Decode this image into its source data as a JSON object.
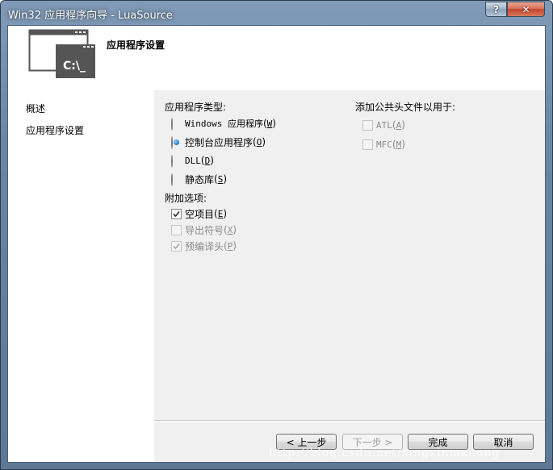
{
  "window": {
    "title": "Win32 应用程序向导 - LuaSource",
    "help_label": "?",
    "close_label": "✕"
  },
  "header": {
    "title": "应用程序设置",
    "logo_text": "C:\\_",
    "logo_icon": "console-window-icon"
  },
  "sidebar": {
    "items": [
      {
        "label": "概述"
      },
      {
        "label": "应用程序设置"
      }
    ]
  },
  "app_type": {
    "label": "应用程序类型:",
    "options": [
      {
        "text": "Windows 应用程序",
        "accel": "W",
        "selected": false
      },
      {
        "text": "控制台应用程序",
        "accel": "O",
        "selected": true
      },
      {
        "text": "DLL",
        "accel": "D",
        "selected": false
      },
      {
        "text": "静态库",
        "accel": "S",
        "selected": false
      }
    ]
  },
  "additional": {
    "label": "附加选项:",
    "options": [
      {
        "text": "空项目",
        "accel": "E",
        "checked": true,
        "enabled": true
      },
      {
        "text": "导出符号",
        "accel": "X",
        "checked": false,
        "enabled": false
      },
      {
        "text": "预编译头",
        "accel": "P",
        "checked": true,
        "enabled": false
      }
    ]
  },
  "common_headers": {
    "label": "添加公共头文件以用于:",
    "options": [
      {
        "text": "ATL",
        "accel": "A",
        "checked": false,
        "enabled": false
      },
      {
        "text": "MFC",
        "accel": "M",
        "checked": false,
        "enabled": false
      }
    ]
  },
  "buttons": {
    "back": "< 上一步",
    "next": "下一步 >",
    "finish": "完成",
    "cancel": "取消"
  },
  "watermark": "http://blog.csdn.net/xingxinmanong",
  "colors": {
    "selected_radio": "#2a80c9",
    "disabled_text": "#8a8a8a"
  }
}
